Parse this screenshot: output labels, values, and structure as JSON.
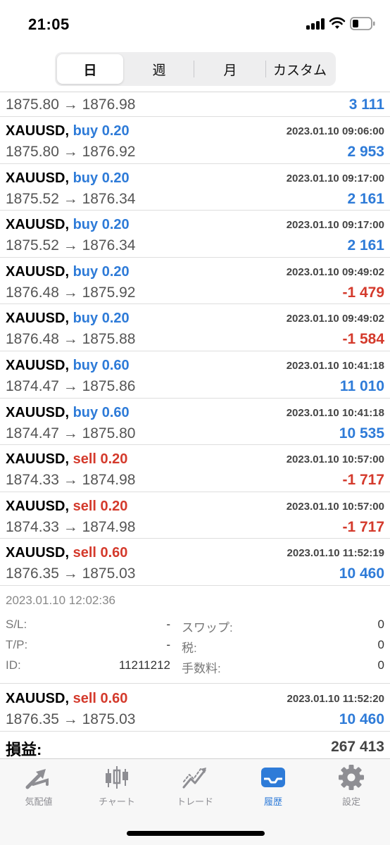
{
  "status": {
    "time": "21:05"
  },
  "tabs_period": [
    "日",
    "週",
    "月",
    "カスタム"
  ],
  "partial_row": {
    "prices": "1875.80 → 1876.98",
    "profit": "3 111"
  },
  "trades": [
    {
      "symbol": "XAUUSD,",
      "side": "buy",
      "volume": "0.20",
      "datetime": "2023.01.10 09:06:00",
      "prices": "1875.80 → 1876.92",
      "profit": "2 953",
      "sign": "pos"
    },
    {
      "symbol": "XAUUSD,",
      "side": "buy",
      "volume": "0.20",
      "datetime": "2023.01.10 09:17:00",
      "prices": "1875.52 → 1876.34",
      "profit": "2 161",
      "sign": "pos"
    },
    {
      "symbol": "XAUUSD,",
      "side": "buy",
      "volume": "0.20",
      "datetime": "2023.01.10 09:17:00",
      "prices": "1875.52 → 1876.34",
      "profit": "2 161",
      "sign": "pos"
    },
    {
      "symbol": "XAUUSD,",
      "side": "buy",
      "volume": "0.20",
      "datetime": "2023.01.10 09:49:02",
      "prices": "1876.48 → 1875.92",
      "profit": "-1 479",
      "sign": "neg"
    },
    {
      "symbol": "XAUUSD,",
      "side": "buy",
      "volume": "0.20",
      "datetime": "2023.01.10 09:49:02",
      "prices": "1876.48 → 1875.88",
      "profit": "-1 584",
      "sign": "neg"
    },
    {
      "symbol": "XAUUSD,",
      "side": "buy",
      "volume": "0.60",
      "datetime": "2023.01.10 10:41:18",
      "prices": "1874.47 → 1875.86",
      "profit": "11 010",
      "sign": "pos"
    },
    {
      "symbol": "XAUUSD,",
      "side": "buy",
      "volume": "0.60",
      "datetime": "2023.01.10 10:41:18",
      "prices": "1874.47 → 1875.80",
      "profit": "10 535",
      "sign": "pos"
    },
    {
      "symbol": "XAUUSD,",
      "side": "sell",
      "volume": "0.20",
      "datetime": "2023.01.10 10:57:00",
      "prices": "1874.33 → 1874.98",
      "profit": "-1 717",
      "sign": "neg"
    },
    {
      "symbol": "XAUUSD,",
      "side": "sell",
      "volume": "0.20",
      "datetime": "2023.01.10 10:57:00",
      "prices": "1874.33 → 1874.98",
      "profit": "-1 717",
      "sign": "neg"
    },
    {
      "symbol": "XAUUSD,",
      "side": "sell",
      "volume": "0.60",
      "datetime": "2023.01.10 11:52:19",
      "prices": "1876.35 → 1875.03",
      "profit": "10 460",
      "sign": "pos"
    }
  ],
  "detail": {
    "open_time": "2023.01.10 12:02:36",
    "sl_label": "S/L:",
    "sl_value": "-",
    "tp_label": "T/P:",
    "tp_value": "-",
    "id_label": "ID:",
    "id_value": "11211212",
    "swap_label": "スワップ:",
    "swap_value": "0",
    "tax_label": "税:",
    "tax_value": "0",
    "fee_label": "手数料:",
    "fee_value": "0"
  },
  "last_trade": {
    "symbol": "XAUUSD,",
    "side": "sell",
    "volume": "0.60",
    "datetime": "2023.01.10 11:52:20",
    "prices": "1876.35 → 1875.03",
    "profit": "10 460"
  },
  "summary": {
    "label": "損益:",
    "value": "267 413"
  },
  "tabbar": [
    {
      "label": "気配値",
      "icon": "quotes-arrows-icon"
    },
    {
      "label": "チャート",
      "icon": "candlestick-chart-icon"
    },
    {
      "label": "トレード",
      "icon": "trade-chart-icon"
    },
    {
      "label": "履歴",
      "icon": "history-inbox-icon"
    },
    {
      "label": "設定",
      "icon": "gear-icon"
    }
  ],
  "colors": {
    "buy": "#2e7bd8",
    "sell": "#d43a2c",
    "tab_active": "#2e7bd8",
    "tab_inactive": "#8e8e93"
  }
}
